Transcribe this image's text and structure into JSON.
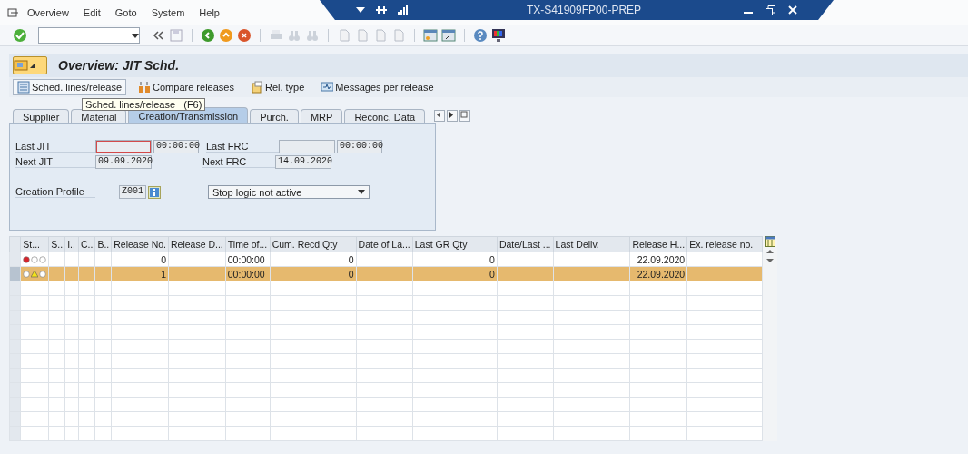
{
  "menu": [
    "Overview",
    "Edit",
    "Goto",
    "System",
    "Help"
  ],
  "window": {
    "title": "TX-S41909FP00-PREP"
  },
  "screen_title": "Overview: JIT Schd.",
  "app_toolbar": [
    {
      "kind": "lines",
      "label": "Sched. lines/release"
    },
    {
      "kind": "compare",
      "label": "Compare releases"
    },
    {
      "kind": "type",
      "label": "Rel. type"
    },
    {
      "kind": "messages",
      "label": "Messages per release"
    }
  ],
  "tooltip": {
    "text": "Sched. lines/release",
    "shortcut": "(F6)"
  },
  "tabs": [
    {
      "label": "Supplier",
      "selected": false
    },
    {
      "label": "Material",
      "selected": false
    },
    {
      "label": "Creation/Transmission",
      "selected": true
    },
    {
      "label": "Purch.",
      "selected": false
    },
    {
      "label": "MRP",
      "selected": false
    },
    {
      "label": "Reconc. Data",
      "selected": false
    }
  ],
  "fields": [
    {
      "label": "Last JIT",
      "highlighted": true,
      "time": "00:00:00"
    },
    {
      "label": "Last FRC",
      "highlighted": false,
      "time": "00:00:00"
    },
    {
      "label": "Next JIT",
      "highlighted": false,
      "value": "09.09.2020"
    },
    {
      "label": "Next FRC",
      "highlighted": false,
      "value": "14.09.2020"
    }
  ],
  "creation_profile": {
    "label": "Creation Profile",
    "value": "Z001"
  },
  "stop_logic": {
    "value": "Stop logic not active"
  },
  "table": {
    "columns": [
      "St...",
      "S..",
      "I..",
      "C..",
      "B..",
      "Release No.",
      "Release D...",
      "Time of...",
      "Cum. Recd Qty",
      "Date of La...",
      "Last GR Qty",
      "Date/Last ...",
      "Last Deliv.",
      "Release H...",
      "Ex. release no."
    ],
    "rows": [
      {
        "selected": false,
        "lights": [
          {
            "lit": true
          },
          {
            "lit": false
          },
          {
            "lit": false
          }
        ],
        "cells": [
          null,
          null,
          null,
          null,
          null,
          "0",
          null,
          "00:00:00",
          "0",
          null,
          "0",
          null,
          null,
          "22.09.2020",
          null
        ]
      },
      {
        "selected": true,
        "lights": [
          {
            "lit": false
          },
          {
            "lit": true
          },
          {
            "lit": false
          }
        ],
        "cells": [
          null,
          null,
          null,
          null,
          null,
          "1",
          null,
          "00:00:00",
          "0",
          null,
          "0",
          null,
          null,
          "22.09.2020",
          null
        ]
      }
    ]
  }
}
